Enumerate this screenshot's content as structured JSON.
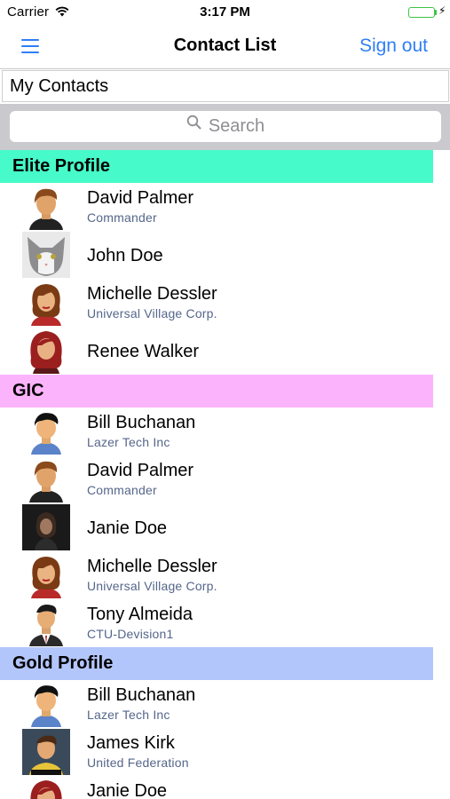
{
  "status_bar": {
    "carrier": "Carrier",
    "time": "3:17 PM"
  },
  "nav": {
    "title": "Contact List",
    "sign_out": "Sign out",
    "menu_icon": "hamburger-menu-icon"
  },
  "group_selector": {
    "value": "My Contacts"
  },
  "search": {
    "placeholder": "Search"
  },
  "colors": {
    "accent": "#2f7ef6",
    "elite": "#46fbc9",
    "gic": "#fbb3fb",
    "gold": "#b3c6fb"
  },
  "sections": [
    {
      "title": "Elite Profile",
      "contacts": [
        {
          "name": "David Palmer",
          "subtitle": "Commander",
          "avatar": "cartoon-man-avatar"
        },
        {
          "name": "John Doe",
          "subtitle": "",
          "avatar": "cat-photo-avatar"
        },
        {
          "name": "Michelle Dessler",
          "subtitle": "Universal Village Corp.",
          "avatar": "cartoon-woman-avatar"
        },
        {
          "name": "Renee Walker",
          "subtitle": "",
          "avatar": "cartoon-redhead-avatar"
        }
      ]
    },
    {
      "title": "GIC",
      "contacts": [
        {
          "name": "Bill Buchanan",
          "subtitle": "Lazer Tech Inc",
          "avatar": "cartoon-man-blue-shirt-avatar"
        },
        {
          "name": "David Palmer",
          "subtitle": "Commander",
          "avatar": "cartoon-man-avatar"
        },
        {
          "name": "Janie Doe",
          "subtitle": "",
          "avatar": "dark-photo-avatar"
        },
        {
          "name": "Michelle Dessler",
          "subtitle": "Universal Village Corp.",
          "avatar": "cartoon-woman-avatar"
        },
        {
          "name": "Tony Almeida",
          "subtitle": "CTU-Devision1",
          "avatar": "cartoon-man-suit-avatar"
        }
      ]
    },
    {
      "title": "Gold Profile",
      "contacts": [
        {
          "name": "Bill Buchanan",
          "subtitle": "Lazer Tech Inc",
          "avatar": "cartoon-man-blue-shirt-avatar"
        },
        {
          "name": "James Kirk",
          "subtitle": "United Federation",
          "avatar": "cartoon-captain-avatar"
        },
        {
          "name": "Janie Doe",
          "subtitle": "",
          "avatar": "cartoon-redhead-avatar"
        }
      ]
    }
  ]
}
